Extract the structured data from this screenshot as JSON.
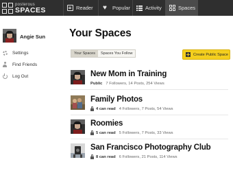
{
  "brand": {
    "small": "posterous",
    "big": "SPACES"
  },
  "nav": {
    "reader": "Reader",
    "popular": "Popular",
    "activity": "Activity",
    "spaces": "Spaces"
  },
  "sidebar": {
    "user_name": "Angie Sun",
    "links": [
      {
        "label": "Settings",
        "icon": "gear-icon"
      },
      {
        "label": "Find Friends",
        "icon": "person-icon"
      },
      {
        "label": "Log Out",
        "icon": "power-icon"
      }
    ]
  },
  "main": {
    "title": "Your Spaces",
    "tabs": [
      "Your Spaces",
      "Spaces You Follow"
    ],
    "active_tab": 0,
    "create_button": "Create Public Space",
    "accent_color": "#f4cf1e",
    "spaces": [
      {
        "title": "New Mom in Training",
        "visibility": "Public",
        "can_read": "",
        "followers": "7 Followers,",
        "posts": "14 Posts,",
        "views": "254 Views"
      },
      {
        "title": "Family Photos",
        "visibility": "",
        "can_read": "4 can read",
        "followers": "4 Followers,",
        "posts": "7 Posts,",
        "views": "54 Views"
      },
      {
        "title": "Roomies",
        "visibility": "",
        "can_read": "5 can read",
        "followers": "5 Followers,",
        "posts": "7 Posts,",
        "views": "33 Views"
      },
      {
        "title": "San Francisco Photography Club",
        "visibility": "",
        "can_read": "8 can read",
        "followers": "6 Followers,",
        "posts": "21 Posts,",
        "views": "114 Views"
      }
    ]
  }
}
